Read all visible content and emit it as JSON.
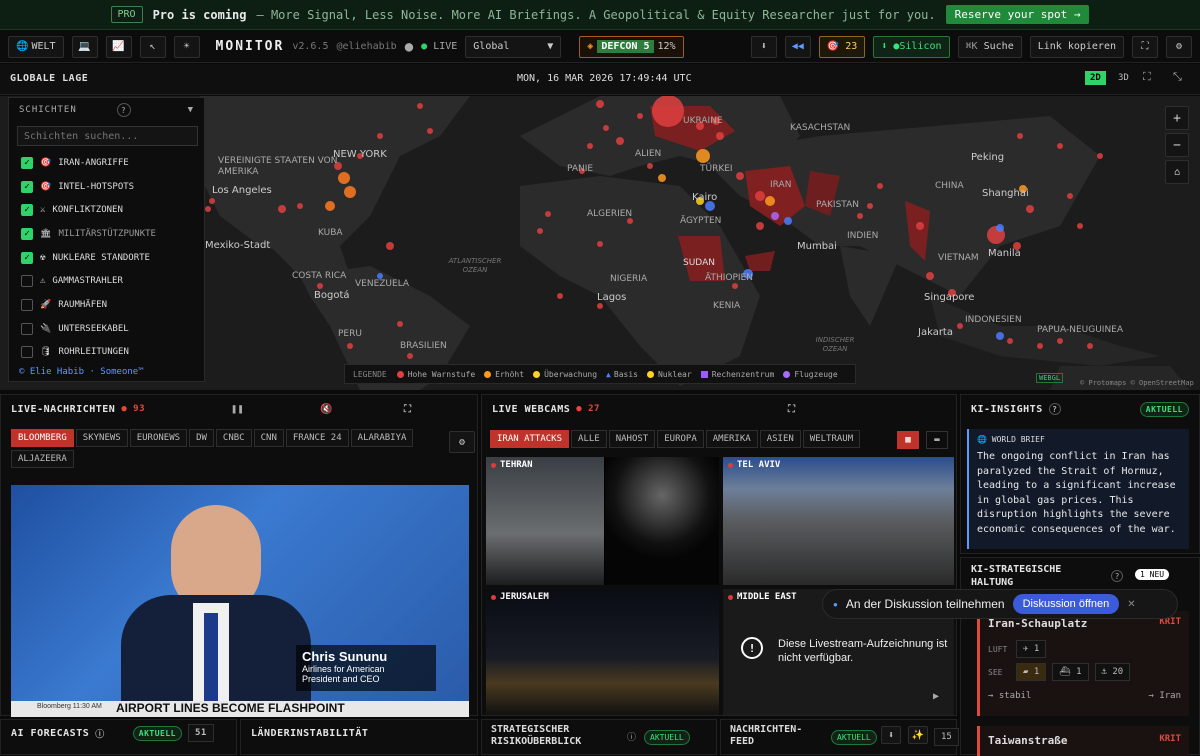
{
  "promo": {
    "badge": "PRO",
    "headline": "Pro is coming",
    "text": "– More Signal, Less Noise. More AI Briefings. A Geopolitical & Equity Researcher just for you.",
    "cta": "Reserve your spot →"
  },
  "topbar": {
    "world_label": "WELT",
    "brand": "MONITOR",
    "version": "v2.6.5",
    "handle": "@eliehabib",
    "live": "LIVE",
    "region": "Global",
    "defcon_label": "DEFCON",
    "defcon_level": "5",
    "defcon_pct": "12%",
    "alerts": "23",
    "silicon": "Silicon",
    "search_shortcut": "⌘K",
    "search": "Suche",
    "copy_link": "Link kopieren"
  },
  "subbar": {
    "title": "GLOBALE LAGE",
    "datetime": "MON, 16 MAR 2026 17:49:44 UTC",
    "view_2d": "2D",
    "view_3d": "3D"
  },
  "layers": {
    "title": "SCHICHTEN",
    "help": "?",
    "search_placeholder": "Schichten suchen...",
    "items": [
      {
        "label": "IRAN-ANGRIFFE",
        "checked": true,
        "icon": "🎯"
      },
      {
        "label": "INTEL-HOTSPOTS",
        "checked": true,
        "icon": "🎯"
      },
      {
        "label": "KONFLIKTZONEN",
        "checked": true,
        "icon": "⚔"
      },
      {
        "label": "MILITÄRSTÜTZPUNKTE",
        "checked": true,
        "icon": "🏛"
      },
      {
        "label": "NUKLEARE STANDORTE",
        "checked": true,
        "icon": "☢"
      },
      {
        "label": "GAMMASTRAHLER",
        "checked": false,
        "icon": "⚠"
      },
      {
        "label": "RAUMHÄFEN",
        "checked": false,
        "icon": "🚀"
      },
      {
        "label": "UNTERSEEKABEL",
        "checked": false,
        "icon": "🔌"
      },
      {
        "label": "ROHRLEITUNGEN",
        "checked": false,
        "icon": "🛢"
      }
    ],
    "footer": "© Elie Habib · Someone™"
  },
  "map": {
    "labels": [
      "NEW YORK",
      "VEREINIGTE STAATEN VON AMERIKA",
      "Los Angeles",
      "Mexiko-Stadt",
      "KUBA",
      "COSTA RICA",
      "Bogotá",
      "VENEZUELA",
      "PERU",
      "BRASILIEN",
      "UKRAINE",
      "KASACHSTAN",
      "PANIE",
      "ALGERIEN",
      "ÄGYPTEN",
      "TÜRKEI",
      "Kairo",
      "IRAN",
      "PAKISTAN",
      "Mumbai",
      "INDIEN",
      "CHINA",
      "Peking",
      "Shanghai",
      "SUDAN",
      "ÄTHIOPIEN",
      "NIGERIA",
      "Lagos",
      "KENIA",
      "VIETNAM",
      "Manila",
      "Singapore",
      "INDONESIEN",
      "Jakarta",
      "PAPUA-NEUGUINEA",
      "ALIEN"
    ],
    "oceans": [
      "ATLANTISCHER OZEAN",
      "INDISCHER OZEAN"
    ],
    "attribution": "© Protomaps © OpenStreetMap",
    "webgl": "WEBGL"
  },
  "legend": {
    "title": "LEGENDE",
    "items": [
      {
        "label": "Hohe Warnstufe",
        "color": "#e04040"
      },
      {
        "label": "Erhöht",
        "color": "#ff9a1f"
      },
      {
        "label": "Überwachung",
        "color": "#ffd21f"
      },
      {
        "label": "Basis",
        "color": "#4a7dff"
      },
      {
        "label": "Nuklear",
        "color": "#ffd21f"
      },
      {
        "label": "Rechenzentrum",
        "color": "#9b5cff"
      },
      {
        "label": "Flugzeuge",
        "color": "#a86bff"
      }
    ]
  },
  "news": {
    "title": "LIVE-NACHRICHTEN",
    "count": "93",
    "channels": [
      "BLOOMBERG",
      "SKYNEWS",
      "EURONEWS",
      "DW",
      "CNBC",
      "CNN",
      "FRANCE 24",
      "ALARABIYA",
      "ALJAZEERA"
    ],
    "video": {
      "name": "Chris Sununu",
      "role1": "Airlines for American",
      "role2": "President and CEO",
      "ticker": "AIRPORT LINES BECOME FLASHPOINT",
      "time": "Bloomberg 11:30 AM"
    }
  },
  "webcams": {
    "title": "LIVE WEBCAMS",
    "count": "27",
    "tabs": [
      "IRAN ATTACKS",
      "ALLE",
      "NAHOST",
      "EUROPA",
      "AMERIKA",
      "ASIEN",
      "WELTRAUM"
    ],
    "cams": [
      "TEHRAN",
      "TEL AVIV",
      "JERUSALEM",
      "MIDDLE EAST"
    ],
    "unavailable": "Diese Livestream-Aufzeichnung ist nicht verfügbar."
  },
  "insights": {
    "title": "KI-INSIGHTS",
    "status": "AKTUELL",
    "brief_title": "WORLD BRIEF",
    "brief": "The ongoing conflict in Iran has paralyzed the Strait of Hormuz, leading to a significant increase in global gas prices. This disruption highlights the severe economic consequences of the war."
  },
  "posture": {
    "title": "KI-STRATEGISCHE HALTUNG",
    "new": "1 NEU",
    "discussion": "An der Diskussion teilnehmen",
    "discussion_btn": "Diskussion öffnen",
    "theaters": [
      {
        "name": "Iran-Schauplatz",
        "level": "KRIT",
        "air_label": "LUFT",
        "air": "1",
        "sea_label": "SEE",
        "sea": [
          "1",
          "1",
          "20"
        ],
        "trend": "→ stabil",
        "target": "→ Iran"
      },
      {
        "name": "Taiwanstraße",
        "level": "KRIT"
      }
    ]
  },
  "bottom": {
    "forecasts": "AI FORECASTS",
    "forecasts_status": "AKTUELL",
    "forecasts_count": "51",
    "instability": "LÄNDERINSTABILITÄT",
    "risk": "STRATEGISCHER RISIKOÜBERBLICK",
    "risk_status": "AKTUELL",
    "feed": "NACHRICHTEN-FEED",
    "feed_status": "AKTUELL",
    "feed_count": "15"
  }
}
